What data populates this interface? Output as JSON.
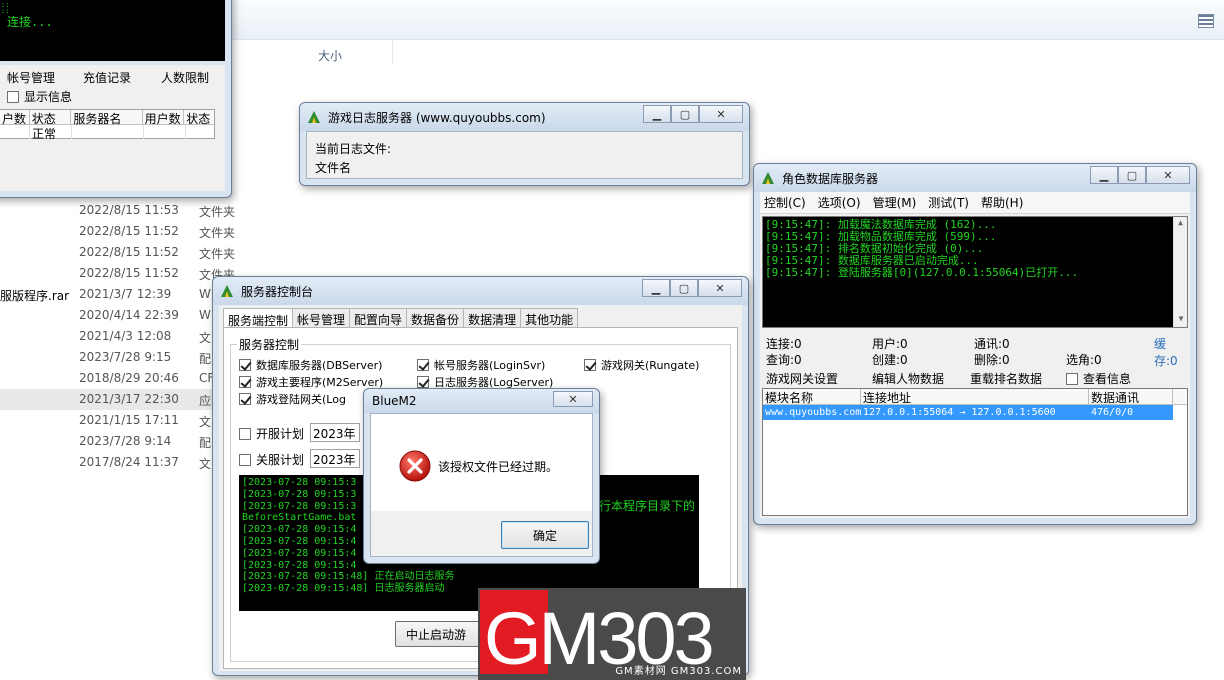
{
  "explorer": {
    "column_size": "大小",
    "rows": [
      {
        "name": "",
        "date": "2022/8/15 11:53",
        "type": "文件夹"
      },
      {
        "name": "",
        "date": "2022/8/15 11:52",
        "type": "文件夹"
      },
      {
        "name": "",
        "date": "2022/8/15 11:52",
        "type": "文件夹"
      },
      {
        "name": "",
        "date": "2022/8/15 11:52",
        "type": "文件夹"
      },
      {
        "name": "服版程序.rar",
        "date": "2021/3/7 12:39",
        "type": "W"
      },
      {
        "name": "",
        "date": "2020/4/14 22:39",
        "type": "W"
      },
      {
        "name": "",
        "date": "2021/4/3 12:08",
        "type": "文"
      },
      {
        "name": "",
        "date": "2023/7/28 9:15",
        "type": "配"
      },
      {
        "name": "",
        "date": "2018/8/29 20:46",
        "type": "CF"
      },
      {
        "name": "",
        "date": "2021/3/17 22:30",
        "type": "应"
      },
      {
        "name": "",
        "date": "2021/1/15 17:11",
        "type": "文"
      },
      {
        "name": "",
        "date": "2023/7/28 9:14",
        "type": "配"
      },
      {
        "name": "",
        "date": "2017/8/24 11:37",
        "type": "文"
      }
    ]
  },
  "login_window": {
    "console_text": "连接...",
    "menu": [
      "帐号管理",
      "充值记录",
      "人数限制"
    ],
    "show_info": "显示信息",
    "table_headers": [
      "户数",
      "状态",
      "服务器名",
      "用户数",
      "状态"
    ],
    "table_row": [
      "",
      "正常",
      "",
      "",
      ""
    ]
  },
  "log_window": {
    "title": "游戏日志服务器 (www.quyoubbs.com)",
    "current_log_label": "当前日志文件:",
    "filename_label": "文件名"
  },
  "db_window": {
    "title": "角色数据库服务器",
    "menu": [
      "控制(C)",
      "选项(O)",
      "管理(M)",
      "测试(T)",
      "帮助(H)"
    ],
    "log_lines": [
      "[9:15:47]: 加载魔法数据库完成 (162)...",
      "[9:15:47]: 加载物品数据库完成 (599)...",
      "[9:15:47]: 排名数据初始化完成 (0)...",
      "[9:15:47]: 数据库服务器已启动完成...",
      "[9:15:47]: 登陆服务器[0](127.0.0.1:55064)已打开..."
    ],
    "stats": {
      "connect": "连接:0",
      "users": "用户:0",
      "comms": "通讯:0",
      "cache": "缓存:0",
      "query": "查询:0",
      "create": "创建:0",
      "delete": "删除:0",
      "select": "选角:0"
    },
    "actions": {
      "gate_settings": "游戏网关设置",
      "edit_char": "编辑人物数据",
      "reload_rank": "重载排名数据",
      "view_info": "查看信息"
    },
    "table_headers": [
      "模块名称",
      "连接地址",
      "数据通讯"
    ],
    "table_row": [
      "www.quyoubbs.com",
      "127.0.0.1:55064 → 127.0.0.1:5600",
      "476/0/0"
    ]
  },
  "console_window": {
    "title": "服务器控制台",
    "tabs": [
      "服务端控制",
      "帐号管理",
      "配置向导",
      "数据备份",
      "数据清理",
      "其他功能"
    ],
    "group_label": "服务器控制",
    "checks": {
      "dbserver": "数据库服务器(DBServer)",
      "loginsrv": "帐号服务器(LoginSvr)",
      "rungate": "游戏网关(Rungate)",
      "m2server": "游戏主要程序(M2Server)",
      "logserver": "日志服务器(LogServer)",
      "login_gate": "游戏登陆网关(Log"
    },
    "schedule_open": "开服计划",
    "schedule_close": "关服计划",
    "year_open": "2023年",
    "year_close": "2023年",
    "trailing_text": "理",
    "log_lines": [
      "[2023-07-28 09:15:3",
      "[2023-07-28 09:15:3",
      "[2023-07-28 09:15:3",
      "BeforeStartGame.bat",
      "[2023-07-28 09:15:4",
      "[2023-07-28 09:15:4",
      "[2023-07-28 09:15:4",
      "[2023-07-28 09:15:4",
      "[2023-07-28 09:15:48] 正在启动日志服务",
      "[2023-07-28 09:15:48] 日志服务器启动"
    ],
    "log_extra": "执行本程序目录下的",
    "stop_button": "中止启动游"
  },
  "dialog": {
    "title": "BlueM2",
    "message": "该授权文件已经过期。",
    "ok": "确定"
  },
  "watermark": {
    "text": "GM303",
    "sub": "GM素材网 GM303.COM"
  },
  "colors": {
    "console_bg": "#000000",
    "console_green": "#22d422",
    "selection": "#3399ff",
    "accent_blue": "#2a6fb8"
  }
}
